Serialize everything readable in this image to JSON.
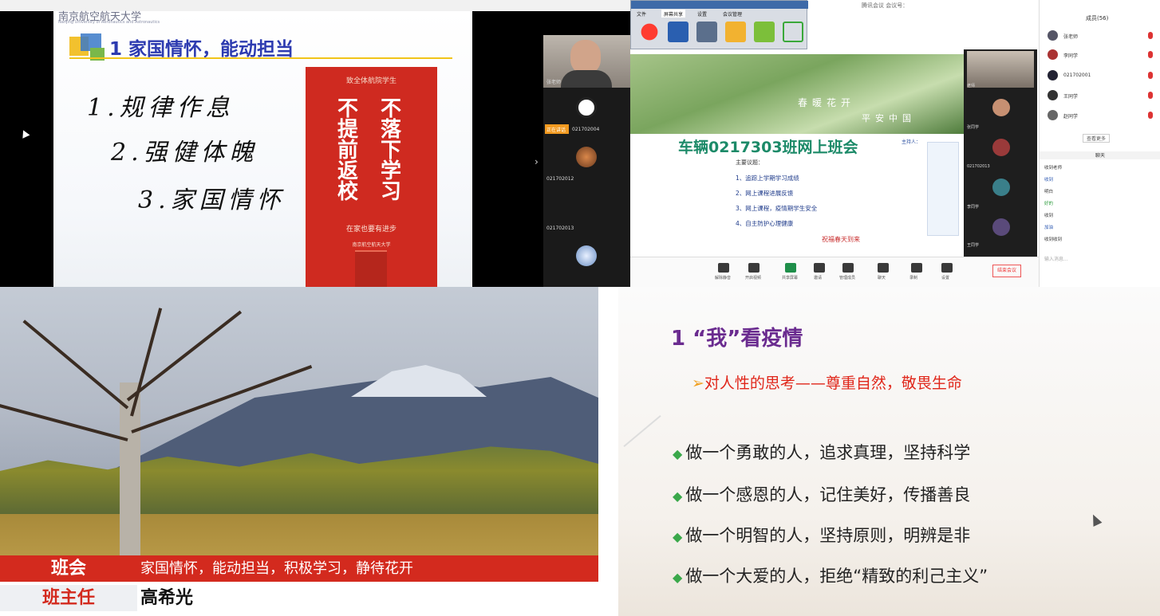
{
  "q1": {
    "university": "南京航空航天大学",
    "university_en": "Nanjing University of Aeronautics and Astronautics",
    "slide_title": "1 家国情怀，能动担当",
    "points": [
      "1.规律作息",
      "2.强健体魄",
      "3.家国情怀"
    ],
    "poster": {
      "top": "致全体航院学生",
      "col1": "不提前返校",
      "col2": "不落下学习",
      "line": "在家也要有进步",
      "org": "南京航空航天大学"
    },
    "participants": [
      {
        "name": "张老师"
      },
      {
        "name": "021702004"
      },
      {
        "name": "021702012"
      },
      {
        "name": "021702013"
      }
    ],
    "speaking_tag": "正在讲话"
  },
  "q2": {
    "window_title": "腾讯会议 会议号：",
    "toolbar_tabs": [
      "文件",
      "屏幕共享",
      "设置",
      "会议管理"
    ],
    "banner_line1": "春暖花开",
    "banner_line2": "平安中国",
    "meeting_title": "车辆0217303班网上班会",
    "agenda_title": "主要议题：",
    "agenda": [
      "1、追踪上学期学习成绩",
      "2、网上课程进展反馈",
      "3、网上课程，疫情期学生安全",
      "4、自主防护心理健康"
    ],
    "host": "主持人：",
    "footer": "祝福春天到来",
    "video_labels": [
      "老师",
      "张同学",
      "021702013",
      "李同学",
      "王同学"
    ],
    "controls": [
      "解除静音",
      "开启视频",
      "共享屏幕",
      "邀请",
      "管理成员",
      "聊天",
      "录制",
      "设置"
    ],
    "end_label": "结束会议",
    "members_title": "成员(56)",
    "members": [
      "张老师",
      "李同学",
      "021702001",
      "王同学",
      "赵同学"
    ],
    "more_label": "查看更多",
    "chat_title": "聊天",
    "chat_messages": [
      "收到老师",
      "收到",
      "明白",
      "好的",
      "收到",
      "加油",
      "收到收到"
    ],
    "chat_input": "输入消息..."
  },
  "q3": {
    "bar1_key": "班会",
    "bar1_value": "家国情怀，能动担当，积极学习，静待花开",
    "bar2_key": "班主任",
    "bar2_value": "高希光"
  },
  "q4": {
    "title": "1 “我”看疫情",
    "subtitle": "对人性的思考——尊重自然，敬畏生命",
    "items": [
      "做一个勇敢的人，追求真理，坚持科学",
      "做一个感恩的人，记住美好，传播善良",
      "做一个明智的人，坚持原则，明辨是非",
      "做一个大爱的人，拒绝“精致的利己主义”"
    ]
  }
}
